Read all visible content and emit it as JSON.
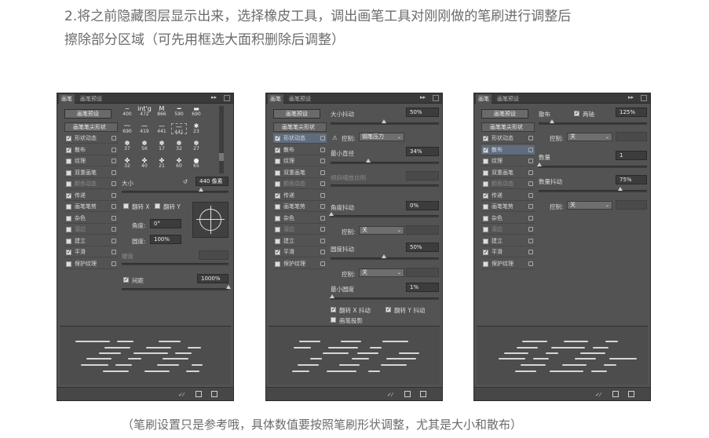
{
  "heading": {
    "line1": "2.将之前隐藏图层显示出来，选择橡皮工具，调出画笔工具对刚刚做的笔刷进行调整后",
    "line2": "擦除部分区域（可先用框选大面积删除后调整）"
  },
  "caption": "（笔刷设置只是参考哦，具体数值要按照笔刷形状调整，尤其是大小和散布）",
  "common": {
    "tab_brush": "画笔",
    "tab_presets": "画笔预设",
    "preset_button": "画笔预设",
    "tip_shape": "画笔笔尖形状",
    "options": [
      "形状动态",
      "散布",
      "纹理",
      "双重画笔",
      "颜色动态",
      "传递",
      "画笔笔势",
      "杂色",
      "湿边",
      "建立",
      "平滑",
      "保护纹理"
    ]
  },
  "panel1": {
    "checked": [
      true,
      true,
      false,
      false,
      false,
      true,
      false,
      false,
      false,
      false,
      true,
      false
    ],
    "dim": [
      false,
      false,
      false,
      false,
      true,
      false,
      false,
      false,
      true,
      false,
      false,
      false
    ],
    "brush_sizes_row1": [
      "400",
      "472",
      "866",
      "590",
      "690"
    ],
    "brush_sizes_row2": [
      "690",
      "419",
      "441",
      "441",
      "23"
    ],
    "brush_sizes_row3": [
      "37",
      "56",
      "17",
      "32",
      "27"
    ],
    "brush_sizes_row4": [
      "32",
      "40",
      "21",
      "60",
      "65"
    ],
    "size_label": "大小",
    "size_value": "440 像素",
    "flip_x": "翻转 X",
    "flip_y": "翻转 Y",
    "angle_label": "角度:",
    "angle_value": "0°",
    "roundness_label": "圆度:",
    "roundness_value": "100%",
    "hardness_label": "硬度",
    "spacing_label": "间距",
    "spacing_value": "1000%"
  },
  "panel2": {
    "selected_index": 0,
    "checked": [
      true,
      true,
      false,
      false,
      false,
      true,
      false,
      false,
      false,
      false,
      true,
      false
    ],
    "dim": [
      false,
      false,
      false,
      false,
      true,
      false,
      false,
      false,
      true,
      false,
      false,
      false
    ],
    "size_jitter_label": "大小抖动",
    "size_jitter_value": "50%",
    "control_label": "控制:",
    "control_value_pen": "钢笔压力",
    "min_diameter_label": "最小直径",
    "min_diameter_value": "34%",
    "tilt_scale_label": "倾斜缩放比例",
    "angle_jitter_label": "角度抖动",
    "angle_jitter_value": "0%",
    "control_off": "关",
    "roundness_jitter_label": "圆度抖动",
    "roundness_jitter_value": "50%",
    "min_roundness_label": "最小圆度",
    "min_roundness_value": "1%",
    "flip_x_jitter": "翻转 X 抖动",
    "flip_y_jitter": "翻转 Y 抖动",
    "brush_projection": "画笔投影"
  },
  "panel3": {
    "selected_index": 1,
    "checked": [
      true,
      true,
      false,
      false,
      false,
      true,
      false,
      false,
      false,
      false,
      true,
      false
    ],
    "dim": [
      false,
      false,
      false,
      false,
      true,
      false,
      false,
      false,
      true,
      false,
      false,
      false
    ],
    "scatter_label": "散布",
    "both_axes_label": "两轴",
    "scatter_value": "125%",
    "control_label": "控制:",
    "control_off": "关",
    "count_label": "数量",
    "count_value": "1",
    "count_jitter_label": "数量抖动",
    "count_jitter_value": "75%"
  }
}
